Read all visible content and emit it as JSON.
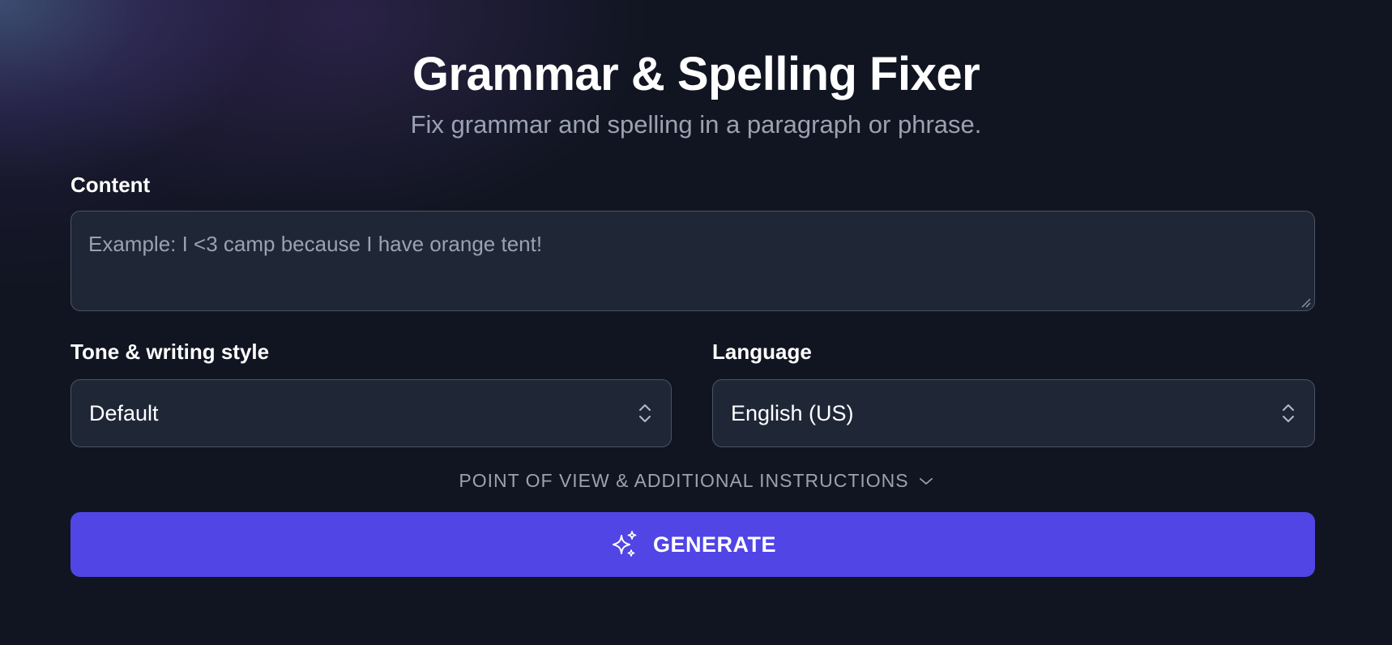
{
  "header": {
    "title": "Grammar & Spelling Fixer",
    "subtitle": "Fix grammar and spelling in a paragraph or phrase."
  },
  "content_field": {
    "label": "Content",
    "value": "",
    "placeholder": "Example: I <3 camp because I have orange tent!"
  },
  "tone_field": {
    "label": "Tone & writing style",
    "selected": "Default"
  },
  "language_field": {
    "label": "Language",
    "selected": "English (US)"
  },
  "disclosure": {
    "label": "POINT OF VIEW & ADDITIONAL INSTRUCTIONS",
    "icon": "chevron-down-icon"
  },
  "generate_button": {
    "label": "GENERATE",
    "icon": "sparkles-icon"
  },
  "colors": {
    "background": "#111521",
    "field_background": "#1f2737",
    "field_border": "#4a5364",
    "muted_text": "#9aa2b2",
    "accent": "#5145e5"
  }
}
